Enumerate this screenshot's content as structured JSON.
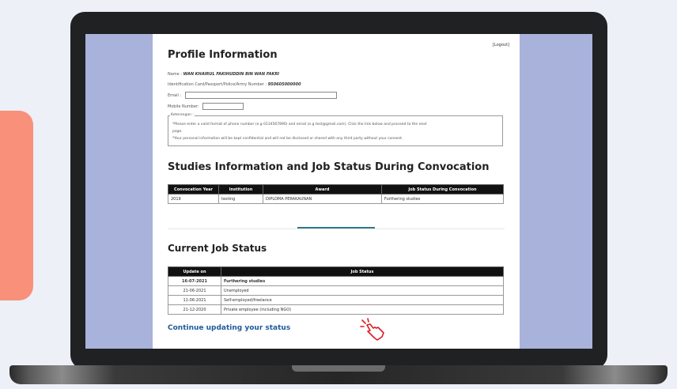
{
  "header": {
    "logout": "[Logout]"
  },
  "profile": {
    "title": "Profile Information",
    "name_label": "Name :",
    "name_value": "WAN KHAIRUL FAKIHUDDIN BIN WAN FAKRI",
    "id_label": "Identification Card/Passport/Police/Army Number :",
    "id_value": "950605000000",
    "email_label": "Email :",
    "email_value": "",
    "mobile_label": "Mobile Number:",
    "mobile_value": "",
    "note_legend": "Keterangan :",
    "note_line1": "*Please enter a valid format of phone number (e.g 0134567890) and email (e.g test@gmail.com). Click the link below and proceed to the next",
    "note_line2": "page.",
    "note_line3": "*Your personal information will be kept confidential and will not be disclosed or shared with any third party without your consent."
  },
  "studies": {
    "title": "Studies Information and Job Status During Convocation",
    "headers": [
      "Convocation Year",
      "Institution",
      "Award",
      "Job Status During Convocation"
    ],
    "rows": [
      [
        "2019",
        "testing",
        "DIPLOMA PERAKAUNAN",
        "Furthering studies"
      ]
    ]
  },
  "current": {
    "title": "Current Job Status",
    "headers": [
      "Update on",
      "Job Status"
    ],
    "rows": [
      [
        "16-07-2021",
        "Furthering studies"
      ],
      [
        "21-06-2021",
        "Unemployed"
      ],
      [
        "11-06-2021",
        "Self-employed/freelance"
      ],
      [
        "21-12-2020",
        "Private employee (including NGO)"
      ]
    ]
  },
  "cta": {
    "continue_label": "Continue updating your status"
  },
  "icons": {
    "cursor": "pointer-hand-icon"
  },
  "colors": {
    "link": "#1d5a9a",
    "accent_divider": "#2e7a8c",
    "cursor": "#d91b24",
    "screen_bg": "#a9b2da"
  }
}
